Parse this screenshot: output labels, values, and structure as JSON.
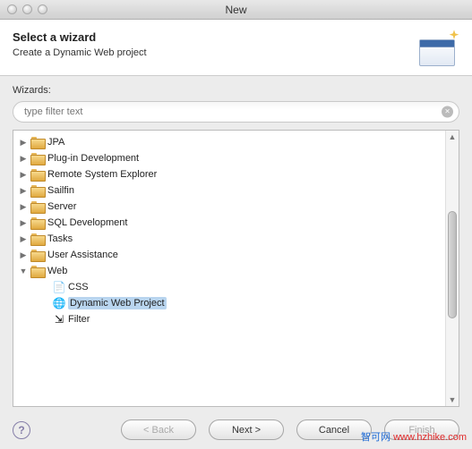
{
  "window": {
    "title": "New"
  },
  "header": {
    "title": "Select a wizard",
    "desc": "Create a Dynamic Web project"
  },
  "filter": {
    "label": "Wizards:",
    "placeholder": "type filter text",
    "clear_glyph": "×"
  },
  "tree": {
    "items": [
      {
        "kind": "folder",
        "label": "JPA",
        "expanded": false
      },
      {
        "kind": "folder",
        "label": "Plug-in Development",
        "expanded": false
      },
      {
        "kind": "folder",
        "label": "Remote System Explorer",
        "expanded": false
      },
      {
        "kind": "folder",
        "label": "Sailfin",
        "expanded": false
      },
      {
        "kind": "folder",
        "label": "Server",
        "expanded": false
      },
      {
        "kind": "folder",
        "label": "SQL Development",
        "expanded": false
      },
      {
        "kind": "folder",
        "label": "Tasks",
        "expanded": false
      },
      {
        "kind": "folder",
        "label": "User Assistance",
        "expanded": false
      },
      {
        "kind": "folder",
        "label": "Web",
        "expanded": true,
        "children": [
          {
            "kind": "leaf",
            "label": "CSS",
            "icon": "css-file-icon",
            "glyph": "📄",
            "selected": false
          },
          {
            "kind": "leaf",
            "label": "Dynamic Web Project",
            "icon": "globe-icon",
            "glyph": "🌐",
            "selected": true
          },
          {
            "kind": "leaf",
            "label": "Filter",
            "icon": "filter-file-icon",
            "glyph": "⇲",
            "selected": false
          }
        ]
      }
    ]
  },
  "buttons": {
    "help": "?",
    "back": "< Back",
    "next": "Next >",
    "cancel": "Cancel",
    "finish": "Finish"
  },
  "scroll": {
    "up": "▲",
    "down": "▼"
  },
  "watermark": {
    "cn": "智可网",
    "url": "www.hzhike.com"
  }
}
